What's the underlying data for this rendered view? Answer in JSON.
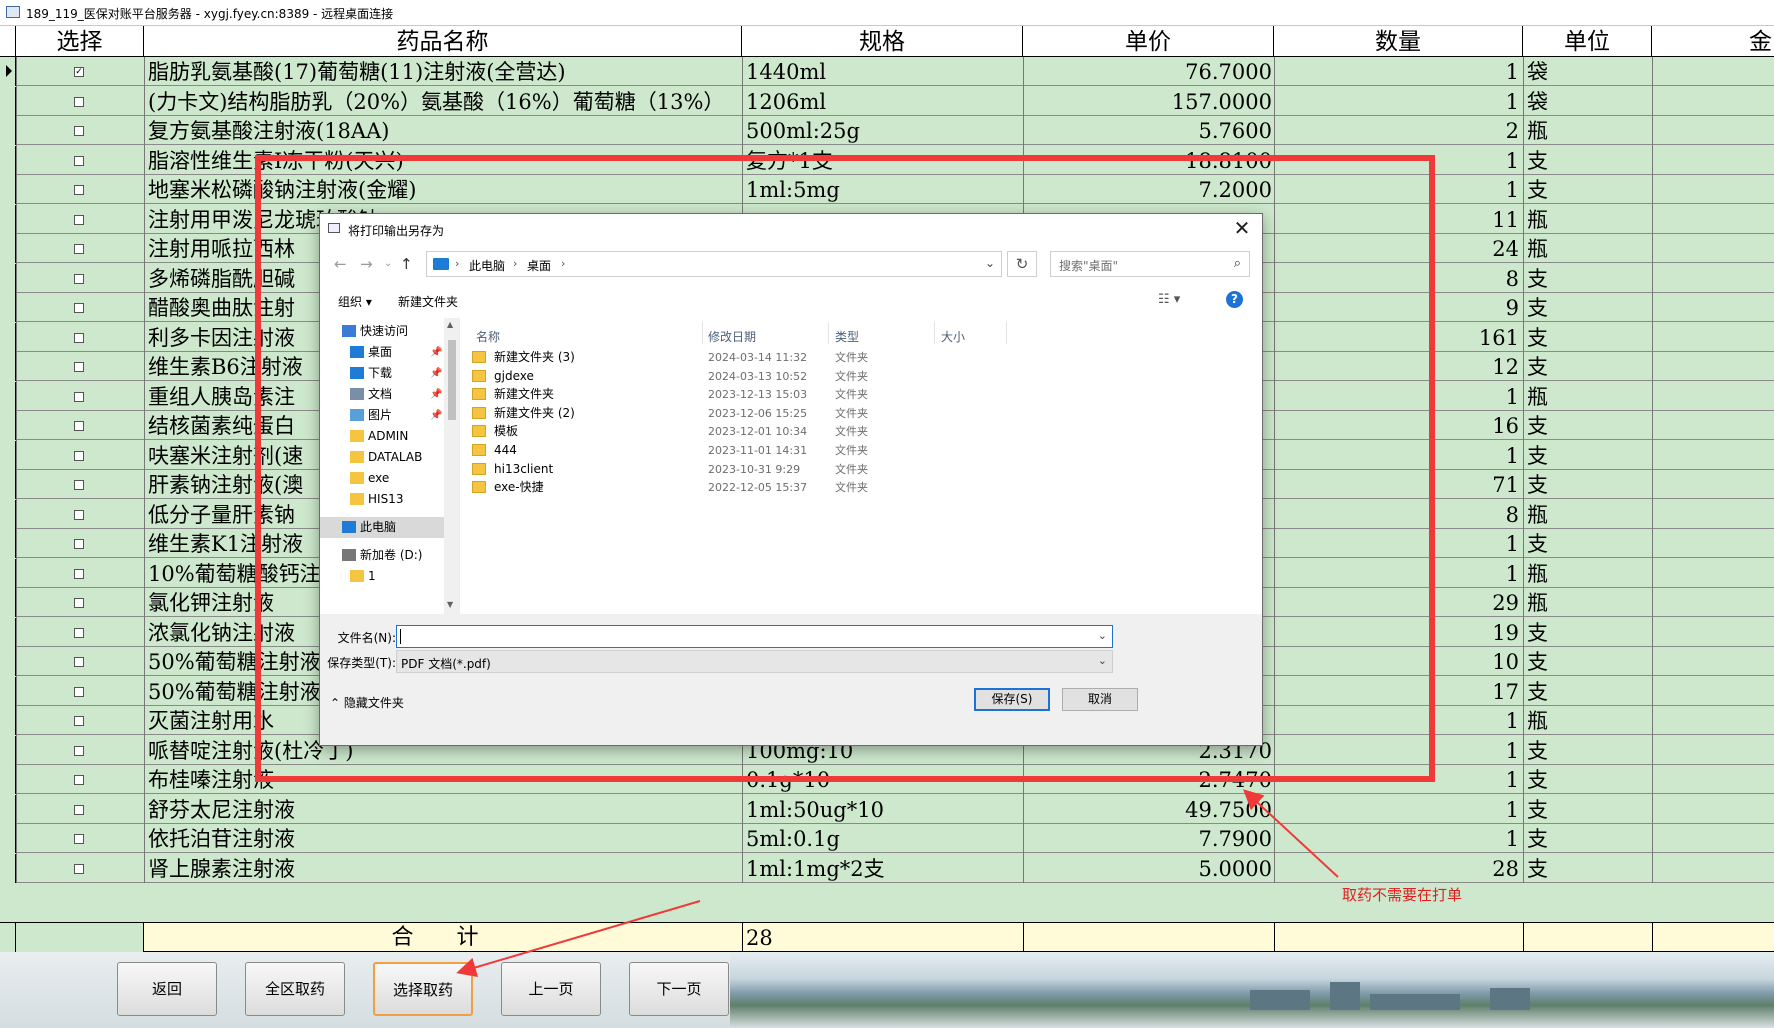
{
  "window": {
    "title": "189_119_医保对账平台服务器 - xygj.fyey.cn:8389 - 远程桌面连接"
  },
  "grid": {
    "columns": [
      "选择",
      "药品名称",
      "规格",
      "单价",
      "数量",
      "单位",
      "金"
    ],
    "rows": [
      {
        "checked": true,
        "name": "脂肪乳氨基酸(17)葡萄糖(11)注射液(全营达)",
        "spec": "1440ml",
        "price": "76.7000",
        "qty": "1",
        "unit": "袋"
      },
      {
        "checked": false,
        "name": "(力卡文)结构脂肪乳（20%）氨基酸（16%）葡萄糖（13%）",
        "spec": "1206ml",
        "price": "157.0000",
        "qty": "1",
        "unit": "袋"
      },
      {
        "checked": false,
        "name": "复方氨基酸注射液(18AA)",
        "spec": "500ml:25g",
        "price": "5.7600",
        "qty": "2",
        "unit": "瓶"
      },
      {
        "checked": false,
        "name": "脂溶性维生素I冻干粉(天兴)",
        "spec": "复方*1支",
        "price": "18.8100",
        "qty": "1",
        "unit": "支"
      },
      {
        "checked": false,
        "name": "地塞米松磷酸钠注射液(金耀)",
        "spec": "1ml:5mg",
        "price": "7.2000",
        "qty": "1",
        "unit": "支"
      },
      {
        "checked": false,
        "name": "注射用甲泼尼龙琥珀酸钠",
        "spec": "",
        "price": "",
        "qty": "11",
        "unit": "瓶"
      },
      {
        "checked": false,
        "name": "注射用哌拉西林",
        "spec": "",
        "price": "",
        "qty": "24",
        "unit": "瓶"
      },
      {
        "checked": false,
        "name": "多烯磷脂酰胆碱",
        "spec": "",
        "price": "",
        "qty": "8",
        "unit": "支"
      },
      {
        "checked": false,
        "name": "醋酸奥曲肽注射",
        "spec": "",
        "price": "",
        "qty": "9",
        "unit": "支"
      },
      {
        "checked": false,
        "name": "利多卡因注射液",
        "spec": "",
        "price": "",
        "qty": "161",
        "unit": "支"
      },
      {
        "checked": false,
        "name": "维生素B6注射液",
        "spec": "",
        "price": "",
        "qty": "12",
        "unit": "支"
      },
      {
        "checked": false,
        "name": "重组人胰岛素注",
        "spec": "",
        "price": "",
        "qty": "1",
        "unit": "瓶"
      },
      {
        "checked": false,
        "name": "结核菌素纯蛋白",
        "spec": "",
        "price": "",
        "qty": "16",
        "unit": "支"
      },
      {
        "checked": false,
        "name": "呋塞米注射剂(速",
        "spec": "",
        "price": "",
        "qty": "1",
        "unit": "支"
      },
      {
        "checked": false,
        "name": "肝素钠注射液(澳",
        "spec": "",
        "price": "",
        "qty": "71",
        "unit": "支"
      },
      {
        "checked": false,
        "name": "低分子量肝素钠",
        "spec": "",
        "price": "",
        "qty": "8",
        "unit": "瓶"
      },
      {
        "checked": false,
        "name": "维生素K1注射液",
        "spec": "",
        "price": "",
        "qty": "1",
        "unit": "支"
      },
      {
        "checked": false,
        "name": "10%葡萄糖酸钙注",
        "spec": "",
        "price": "",
        "qty": "1",
        "unit": "瓶"
      },
      {
        "checked": false,
        "name": "氯化钾注射液",
        "spec": "",
        "price": "",
        "qty": "29",
        "unit": "瓶"
      },
      {
        "checked": false,
        "name": "浓氯化钠注射液",
        "spec": "",
        "price": "",
        "qty": "19",
        "unit": "支"
      },
      {
        "checked": false,
        "name": "50%葡萄糖注射液",
        "spec": "",
        "price": "",
        "qty": "10",
        "unit": "支"
      },
      {
        "checked": false,
        "name": "50%葡萄糖注射液",
        "spec": "",
        "price": "",
        "qty": "17",
        "unit": "支"
      },
      {
        "checked": false,
        "name": "灭菌注射用水",
        "spec": "",
        "price": "",
        "qty": "1",
        "unit": "瓶"
      },
      {
        "checked": false,
        "name": "哌替啶注射液(杜冷丁)",
        "spec": "100mg:10",
        "price": "2.3170",
        "qty": "1",
        "unit": "支"
      },
      {
        "checked": false,
        "name": "布桂嗪注射液",
        "spec": "0.1g*10",
        "price": "2.7470",
        "qty": "1",
        "unit": "支"
      },
      {
        "checked": false,
        "name": "舒芬太尼注射液",
        "spec": "1ml:50ug*10",
        "price": "49.7500",
        "qty": "1",
        "unit": "支"
      },
      {
        "checked": false,
        "name": "依托泊苷注射液",
        "spec": "5ml:0.1g",
        "price": "7.7900",
        "qty": "1",
        "unit": "支"
      },
      {
        "checked": false,
        "name": "肾上腺素注射液",
        "spec": "1ml:1mg*2支",
        "price": "5.0000",
        "qty": "28",
        "unit": "支"
      }
    ],
    "total_label": "合 计",
    "total_value": "28"
  },
  "toolbar": {
    "buttons": [
      "返回",
      "全区取药",
      "选择取药",
      "上一页",
      "下一页"
    ],
    "active": "选择取药"
  },
  "annotation": {
    "text": "取药不需要在打单",
    "color": "#f03a3a"
  },
  "dialog": {
    "title": "将打印输出另存为",
    "breadcrumb": [
      "此电脑",
      "桌面"
    ],
    "search_placeholder": "搜索\"桌面\"",
    "organize": "组织 ▾",
    "new_folder": "新建文件夹",
    "nav": [
      {
        "label": "快速访问",
        "icon": "star-icon"
      },
      {
        "label": "桌面",
        "icon": "desktop-icon",
        "pinned": true
      },
      {
        "label": "下载",
        "icon": "download-icon",
        "pinned": true
      },
      {
        "label": "文档",
        "icon": "document-icon",
        "pinned": true
      },
      {
        "label": "图片",
        "icon": "picture-icon",
        "pinned": true
      },
      {
        "label": "ADMIN",
        "icon": "folder-icon"
      },
      {
        "label": "DATALAB",
        "icon": "folder-icon"
      },
      {
        "label": "exe",
        "icon": "folder-icon"
      },
      {
        "label": "HIS13",
        "icon": "folder-icon"
      },
      {
        "label": "此电脑",
        "icon": "computer-icon",
        "selected": true
      },
      {
        "label": "新加卷 (D:)",
        "icon": "drive-icon"
      },
      {
        "label": "1",
        "icon": "folder-icon"
      }
    ],
    "columns": [
      "名称",
      "修改日期",
      "类型",
      "大小"
    ],
    "files": [
      {
        "name": "新建文件夹 (3)",
        "date": "2024-03-14 11:32",
        "type": "文件夹"
      },
      {
        "name": "gjdexe",
        "date": "2024-03-13 10:52",
        "type": "文件夹"
      },
      {
        "name": "新建文件夹",
        "date": "2023-12-13 15:03",
        "type": "文件夹"
      },
      {
        "name": "新建文件夹 (2)",
        "date": "2023-12-06 15:25",
        "type": "文件夹"
      },
      {
        "name": "模板",
        "date": "2023-12-01 10:34",
        "type": "文件夹"
      },
      {
        "name": "444",
        "date": "2023-11-01 14:31",
        "type": "文件夹"
      },
      {
        "name": "hi13client",
        "date": "2023-10-31 9:29",
        "type": "文件夹"
      },
      {
        "name": "exe-快捷",
        "date": "2022-12-05 15:37",
        "type": "文件夹"
      }
    ],
    "filename_label": "文件名(N):",
    "filename_value": "",
    "filetype_label": "保存类型(T):",
    "filetype_value": "PDF 文档(*.pdf)",
    "hide_folders": "隐藏文件夹",
    "save": "保存(S)",
    "cancel": "取消"
  }
}
